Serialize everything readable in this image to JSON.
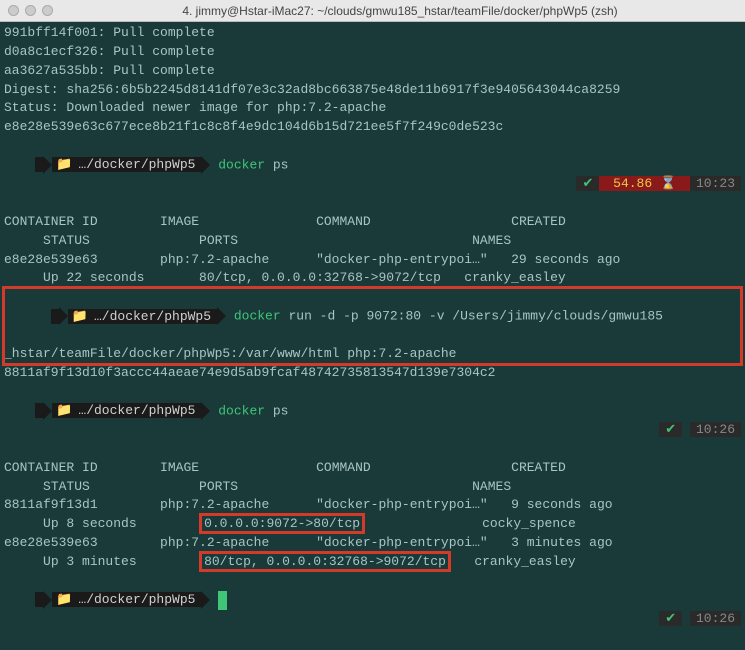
{
  "window": {
    "title": "4. jimmy@Hstar-iMac27: ~/clouds/gmwu185_hstar/teamFile/docker/phpWp5 (zsh)"
  },
  "pull": {
    "l1": "991bff14f001: Pull complete",
    "l2": "d0a8c1ecf326: Pull complete",
    "l3": "aa3627a535bb: Pull complete",
    "digest": "Digest: sha256:6b5b2245d8141df07e3c32ad8bc663875e48de11b6917f3e9405643044ca8259",
    "status": "Status: Downloaded newer image for php:7.2-apache",
    "hash": "e8e28e539e63c677ece8b21f1c8c8f4e9dc104d6b15d721ee5f7f249c0de523c"
  },
  "prompt": {
    "apple": "⌘",
    "folder": "📁",
    "path": "…/docker/phpWp5"
  },
  "cmds": {
    "ps1": "docker",
    "ps1_args": "ps",
    "run": "docker",
    "run_args1": "run -d -p 9072:80 -v /Users/jimmy/clouds/gmwu185",
    "run_args2": "_hstar/teamFile/docker/phpWp5:/var/www/html php:7.2-apache",
    "run_result": "8811af9f13d10f3accc44aeae74e9d5ab9fcaf48742735813547d139e7304c2",
    "ps2": "docker",
    "ps2_args": "ps"
  },
  "status": {
    "load": "54.86",
    "t1": "10:23",
    "t2": "10:26",
    "t3": "10:26",
    "check": "✔"
  },
  "headers": {
    "cid": "CONTAINER ID",
    "img": "IMAGE",
    "cmd": "COMMAND",
    "created": "CREATED",
    "status": "STATUS",
    "ports": "PORTS",
    "names": "NAMES"
  },
  "rows1": [
    {
      "cid": "e8e28e539e63",
      "img": "php:7.2-apache",
      "cmd": "\"docker-php-entrypoi…\"",
      "created": "29 seconds ago",
      "status": "Up 22 seconds",
      "ports": "80/tcp, 0.0.0.0:32768->9072/tcp",
      "names": "cranky_easley"
    }
  ],
  "rows2": [
    {
      "cid": "8811af9f13d1",
      "img": "php:7.2-apache",
      "cmd": "\"docker-php-entrypoi…\"",
      "created": "9 seconds ago",
      "status": "Up 8 seconds",
      "ports": "0.0.0.0:9072->80/tcp",
      "names": "cocky_spence"
    },
    {
      "cid": "e8e28e539e63",
      "img": "php:7.2-apache",
      "cmd": "\"docker-php-entrypoi…\"",
      "created": "3 minutes ago",
      "status": "Up 3 minutes",
      "ports": "80/tcp, 0.0.0.0:32768->9072/tcp",
      "names": "cranky_easley"
    }
  ]
}
